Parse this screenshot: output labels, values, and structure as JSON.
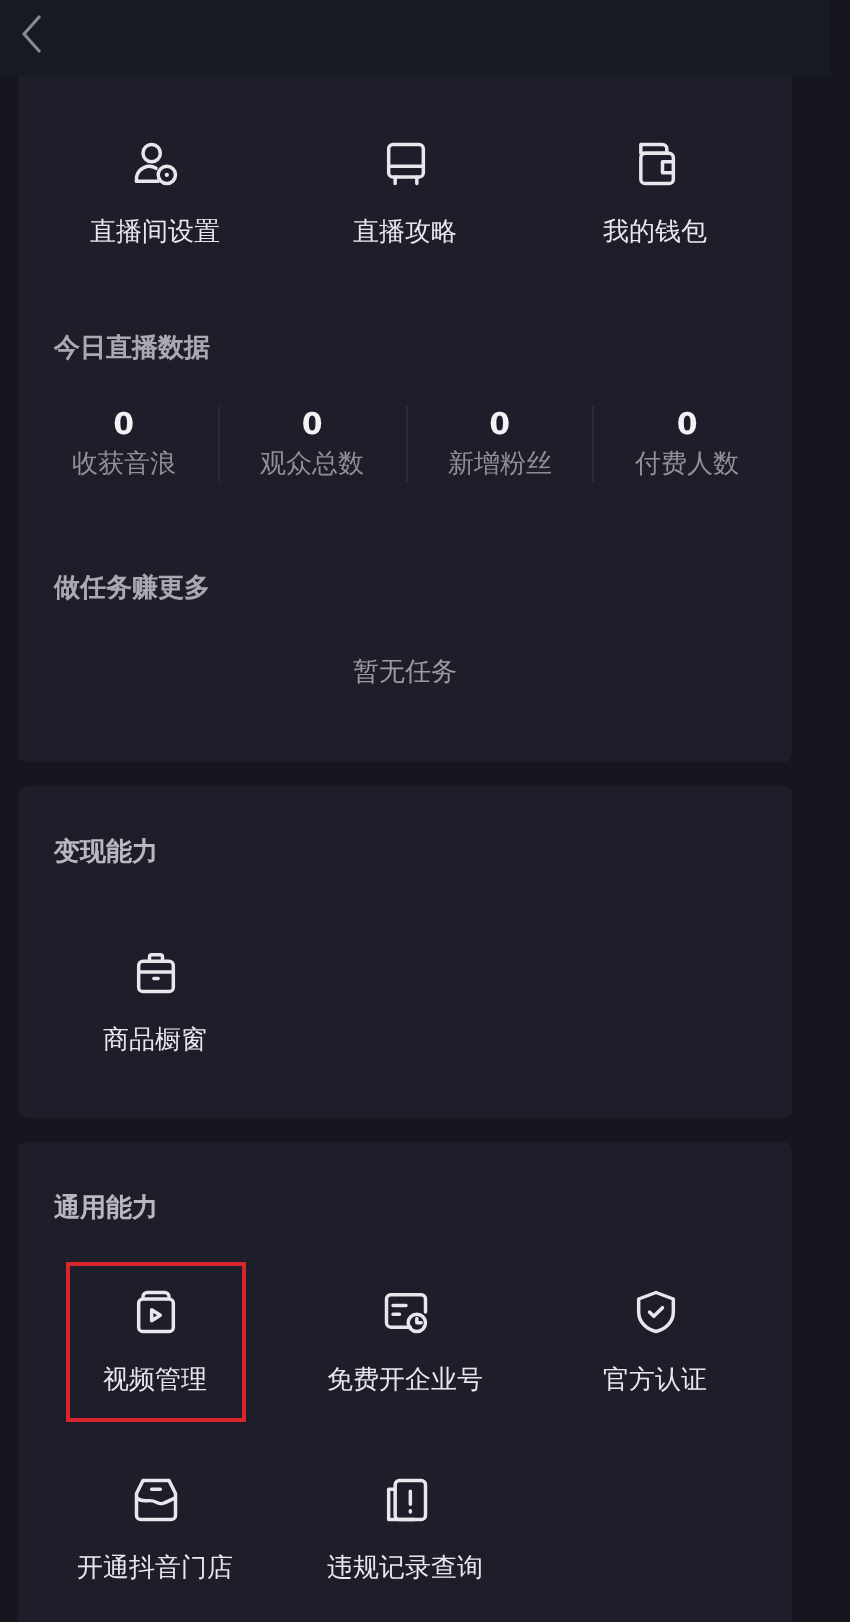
{
  "live_section": {
    "tools": [
      {
        "kind": "user-gear",
        "label": "直播间设置"
      },
      {
        "kind": "suitcase",
        "label": "直播攻略"
      },
      {
        "kind": "wallet",
        "label": "我的钱包"
      }
    ],
    "stats_title": "今日直播数据",
    "stats": [
      {
        "value": "0",
        "label": "收获音浪"
      },
      {
        "value": "0",
        "label": "观众总数"
      },
      {
        "value": "0",
        "label": "新增粉丝"
      },
      {
        "value": "0",
        "label": "付费人数"
      }
    ],
    "tasks_title": "做任务赚更多",
    "tasks_empty": "暂无任务"
  },
  "monetize_section": {
    "title": "变现能力",
    "items": [
      {
        "kind": "briefcase",
        "label": "商品橱窗",
        "highlighted": false
      }
    ]
  },
  "general_section": {
    "title": "通用能力",
    "items": [
      {
        "kind": "video",
        "label": "视频管理",
        "highlighted": true
      },
      {
        "kind": "card-clock",
        "label": "免费开企业号",
        "highlighted": false
      },
      {
        "kind": "shield",
        "label": "官方认证",
        "highlighted": false
      },
      {
        "kind": "store",
        "label": "开通抖音门店",
        "highlighted": false
      },
      {
        "kind": "alert-doc",
        "label": "违规记录查询",
        "highlighted": false
      }
    ]
  }
}
